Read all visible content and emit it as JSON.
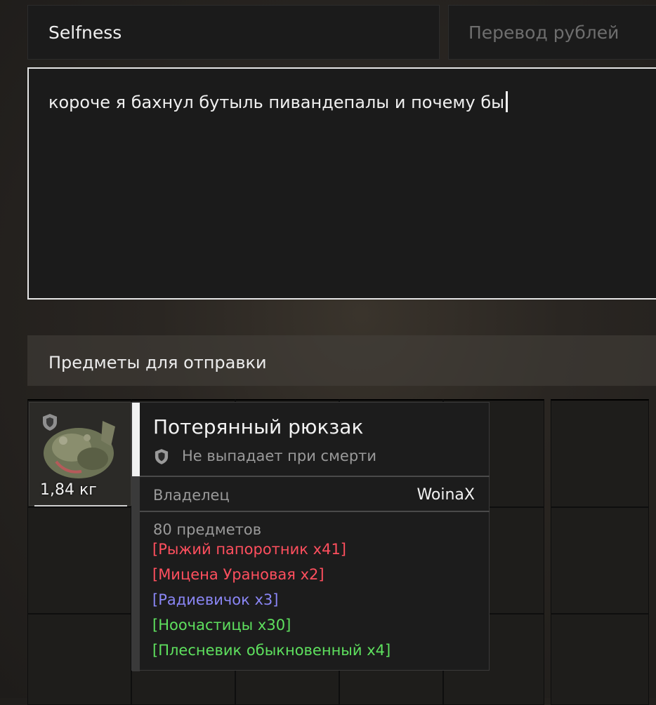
{
  "recipient": {
    "value": "Selfness"
  },
  "amount": {
    "placeholder": "Перевод рублей"
  },
  "message": {
    "value": "короче я бахнул бутыль пивандепалы и почему бы"
  },
  "items_section": {
    "title": "Предметы для отправки"
  },
  "slot_item": {
    "weight": "1,84 кг",
    "icon": "backpack-icon",
    "badge_icon": "shield-icon"
  },
  "tooltip": {
    "title": "Потерянный рюкзак",
    "flag_icon": "shield-icon",
    "flag": "Не выпадает при смерти",
    "owner_label": "Владелец",
    "owner": "WoinaX",
    "count": "80 предметов",
    "contents": [
      {
        "text": "[Рыжий папоротник x41]",
        "color": "#ff4f5e"
      },
      {
        "text": "[Мицена Урановая x2]",
        "color": "#ff4f5e"
      },
      {
        "text": "[Радиевичок x3]",
        "color": "#8a86f5"
      },
      {
        "text": "[Ноочастицы x30]",
        "color": "#5ee05e"
      },
      {
        "text": "[Плесневик обыкновенный x4]",
        "color": "#5ee05e"
      }
    ]
  },
  "colors": {
    "accent_border": "#e6e6e6",
    "panel": "#1b1b1b"
  }
}
